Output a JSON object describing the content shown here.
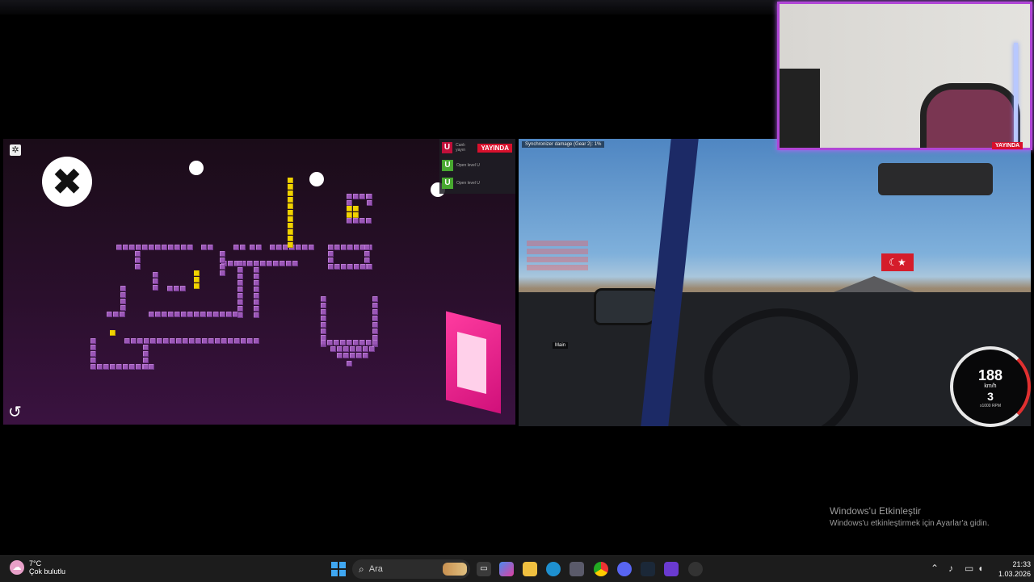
{
  "left_game": {
    "gear_icon": "gear-icon",
    "close_icon": "close-icon",
    "close_glyph": "✖",
    "undo_icon": "undo-icon",
    "undo_glyph": "↺",
    "gear_glyph": "✲"
  },
  "stream_overlay": {
    "live_badge": "YAYINDA",
    "rows": [
      {
        "letter": "U",
        "sub": "Canlı yayın"
      },
      {
        "letter": "U",
        "sub": "Open level U"
      },
      {
        "letter": "U",
        "sub": "Open level U"
      }
    ]
  },
  "driving": {
    "damage_message": "Synchronizer damage (Gear 2): 1%",
    "main_label": "Main",
    "flag_symbol": "☾★",
    "speed": "188",
    "speed_unit": "km/h",
    "gear": "3",
    "rpm_unit": "x1000 RPM"
  },
  "webcam": {
    "badge": "YAYINDA"
  },
  "activation": {
    "title": "Windows'u Etkinleştir",
    "subtitle": "Windows'u etkinleştirmek için Ayarlar'a gidin."
  },
  "taskbar": {
    "weather_temp": "7°C",
    "weather_desc": "Çok bulutlu",
    "weather_icon": "weather-icon",
    "search_placeholder": "Ara",
    "time": "21:33",
    "date": "1.03.2026"
  },
  "colors": {
    "accent_purple": "#b046d6",
    "live_red": "#d8102c",
    "game_tile": "#9a56b6"
  }
}
